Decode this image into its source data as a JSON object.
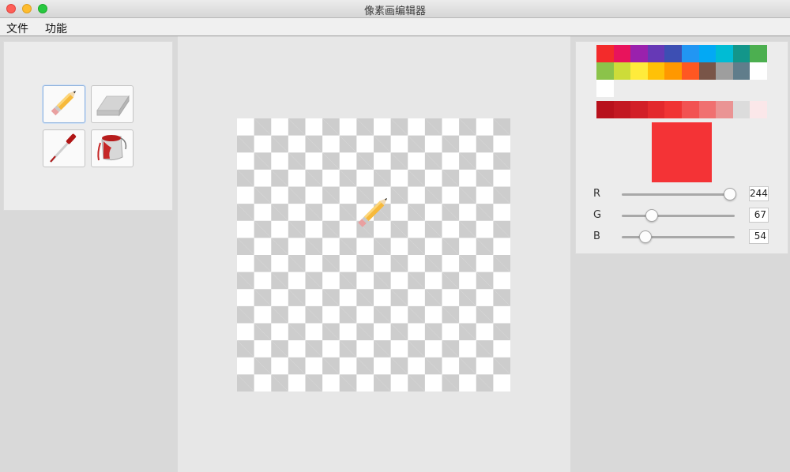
{
  "window": {
    "title": "像素画编辑器"
  },
  "menu": {
    "file": "文件",
    "function": "功能"
  },
  "tools": [
    {
      "name": "pencil",
      "icon": "pencil-icon",
      "selected": true
    },
    {
      "name": "eraser",
      "icon": "eraser-icon",
      "selected": false
    },
    {
      "name": "eyedropper",
      "icon": "eyedropper-icon",
      "selected": false
    },
    {
      "name": "paint-bucket",
      "icon": "paint-bucket-icon",
      "selected": false
    }
  ],
  "canvas": {
    "cursor_icon": "pencil-icon"
  },
  "palette": {
    "colors": [
      "#f32b2b",
      "#e8135c",
      "#9a21ad",
      "#6639b6",
      "#3d4fb3",
      "#2196f3",
      "#03a9f4",
      "#00bcd4",
      "#13968a",
      "#4caf50",
      "#8bc34a",
      "#cddc39",
      "#ffeb3b",
      "#ffc107",
      "#ff9800",
      "#ff5722",
      "#795548",
      "#9e9e9e",
      "#607d8b",
      "#ffffff",
      "#ffffff"
    ],
    "tints": [
      "#b8111c",
      "#c31822",
      "#d21f28",
      "#e3292d",
      "#f03434",
      "#f25252",
      "#f07070",
      "#ea9494",
      "#dcdcdc",
      "#fbe7e9"
    ],
    "current_color": "#f43336"
  },
  "rgb": {
    "r": {
      "label": "R",
      "value": "244",
      "fraction": 0.957
    },
    "g": {
      "label": "G",
      "value": "67",
      "fraction": 0.263
    },
    "b": {
      "label": "B",
      "value": "54",
      "fraction": 0.212
    }
  }
}
